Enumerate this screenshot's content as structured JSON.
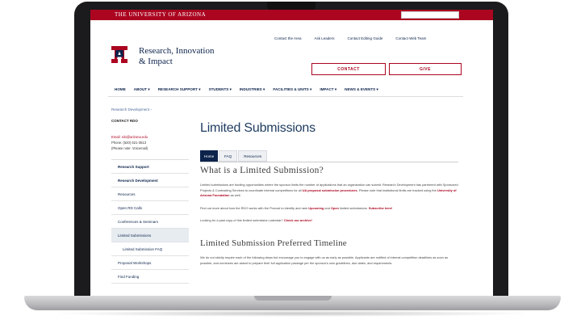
{
  "topbar": {
    "university": "THE UNIVERSITY OF ARIZONA"
  },
  "header": {
    "site_title_line1": "Research, Innovation",
    "site_title_line2": "& Impact",
    "utility_links": [
      "Contact the Area",
      "Ask Leaders",
      "Contact Editing Guide",
      "Contact Web Team"
    ],
    "contact_button": "CONTACT",
    "give_button": "GIVE"
  },
  "nav": {
    "items": [
      "HOME",
      "ABOUT ▾",
      "RESEARCH SUPPORT ▾",
      "STUDENTS ▾",
      "INDUSTRIES ▾",
      "FACILITIES & UNITS ▾",
      "IMPACT ▾",
      "NEWS & EVENTS ▾"
    ]
  },
  "breadcrumb": "Research Development ›",
  "sidebar": {
    "contact_label": "CONTACT RDO",
    "contact_email": "Email: rdo@arizona.edu",
    "contact_phone": "Phone: (520) 621-3513",
    "contact_extra": "(Please note: Voicemail)",
    "menu": [
      {
        "label": "Research Support"
      },
      {
        "label": "Research Development"
      },
      {
        "label": "Resources"
      },
      {
        "label": "Open RD Calls"
      },
      {
        "label": "Conferences & Seminars"
      },
      {
        "label": "Limited Submissions"
      },
      {
        "label": "Limited Submission FAQ"
      },
      {
        "label": "Proposal Workshops"
      },
      {
        "label": "Find Funding"
      }
    ]
  },
  "main": {
    "title": "Limited Submissions",
    "tabs": [
      "Home",
      "FAQ",
      "Resources"
    ],
    "h2": "What is a Limited Submission?",
    "para1_a": "Limited submissions are funding opportunities where the sponsor limits the number of applications that an organization can submit. Research Development has partnered with Sponsored Projects & Contracting Services to coordinate internal competitions for all ",
    "para1_red1": "UA proposal submission procedures",
    "para1_b": ". Please note that institutional limits are tracked using the ",
    "para1_red2": "University of Arizona Foundation",
    "para1_c": " as well.",
    "para2_a": "Find out more about how the RDO works with the Provost to identify and rank ",
    "para2_red1": "Upcoming",
    "para2_b": " and ",
    "para2_red2": "Open",
    "para2_c": " limited submissions. ",
    "para2_red3": "Subscribe here!",
    "para3_a": "Looking for a past copy of this limited submission calendar? ",
    "para3_red": "Check our archive!",
    "h2b": "Limited Submission Preferred Timeline",
    "para4": "We do not strictly require each of the following steps but encourage you to engage with us as early as possible. Applicants are notified of internal competition deadlines as soon as possible, and nominees are asked to prepare their full application package per the sponsor's own guidelines, due dates, and requirements."
  }
}
